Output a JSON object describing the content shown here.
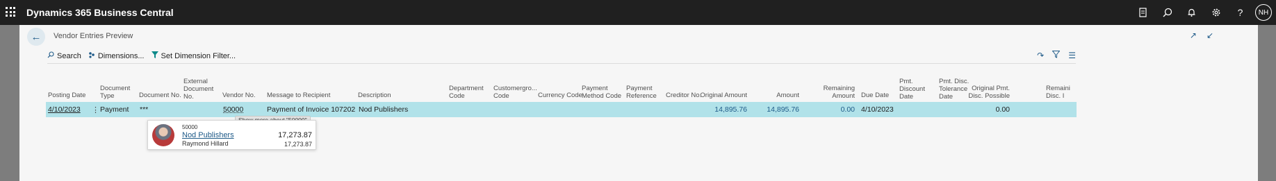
{
  "app": {
    "title": "Dynamics 365 Business Central",
    "user_initials": "NH"
  },
  "page": {
    "title": "Vendor Entries Preview"
  },
  "actions": {
    "search": "Search",
    "dimensions": "Dimensions...",
    "set_dimension_filter": "Set Dimension Filter..."
  },
  "columns": {
    "posting_date": "Posting Date",
    "document_type": [
      "Document",
      "Type"
    ],
    "document_no": "Document No.",
    "external_document_no": [
      "External",
      "Document",
      "No."
    ],
    "vendor_no": "Vendor No.",
    "message_to_recipient": "Message to Recipient",
    "description": "Description",
    "department_code": [
      "Department",
      "Code"
    ],
    "customergroup_code": [
      "Customergro...",
      "Code"
    ],
    "currency_code": "Currency Code",
    "payment_method_code": [
      "Payment",
      "Method Code"
    ],
    "payment_reference": [
      "Payment",
      "Reference"
    ],
    "creditor_no": "Creditor No.",
    "original_amount": "Original Amount",
    "amount": "Amount",
    "remaining_amount": [
      "Remaining",
      "Amount"
    ],
    "due_date": "Due Date",
    "pmt_discount_date": [
      "Pmt.",
      "Discount",
      "Date"
    ],
    "pmt_disc_tolerance_date": [
      "Pmt. Disc.",
      "Tolerance",
      "Date"
    ],
    "original_pmt_disc_possible": [
      "Original Pmt.",
      "Disc. Possible"
    ],
    "remaining_pmt_disc": [
      "Remaini",
      "Disc. I"
    ]
  },
  "row": {
    "posting_date": "4/10/2023",
    "document_type": "Payment",
    "document_no": "***",
    "vendor_no": "50000",
    "message_to_recipient": "Payment of Invoice 107202",
    "description": "Nod Publishers",
    "original_amount": "14,895.76",
    "amount": "14,895.76",
    "remaining_amount": "0.00",
    "due_date": "4/10/2023",
    "original_pmt_disc_possible": "0.00"
  },
  "tooltip": "Show more about \"50000\"",
  "vendor_card": {
    "number": "50000",
    "name": "Nod Publishers",
    "contact": "Raymond Hillard",
    "balance": "17,273.87",
    "balance_secondary": "17,273.87"
  },
  "colors": {
    "topbar": "#202020",
    "selected_row": "#b1e2e9",
    "accent": "#1e5a88"
  }
}
